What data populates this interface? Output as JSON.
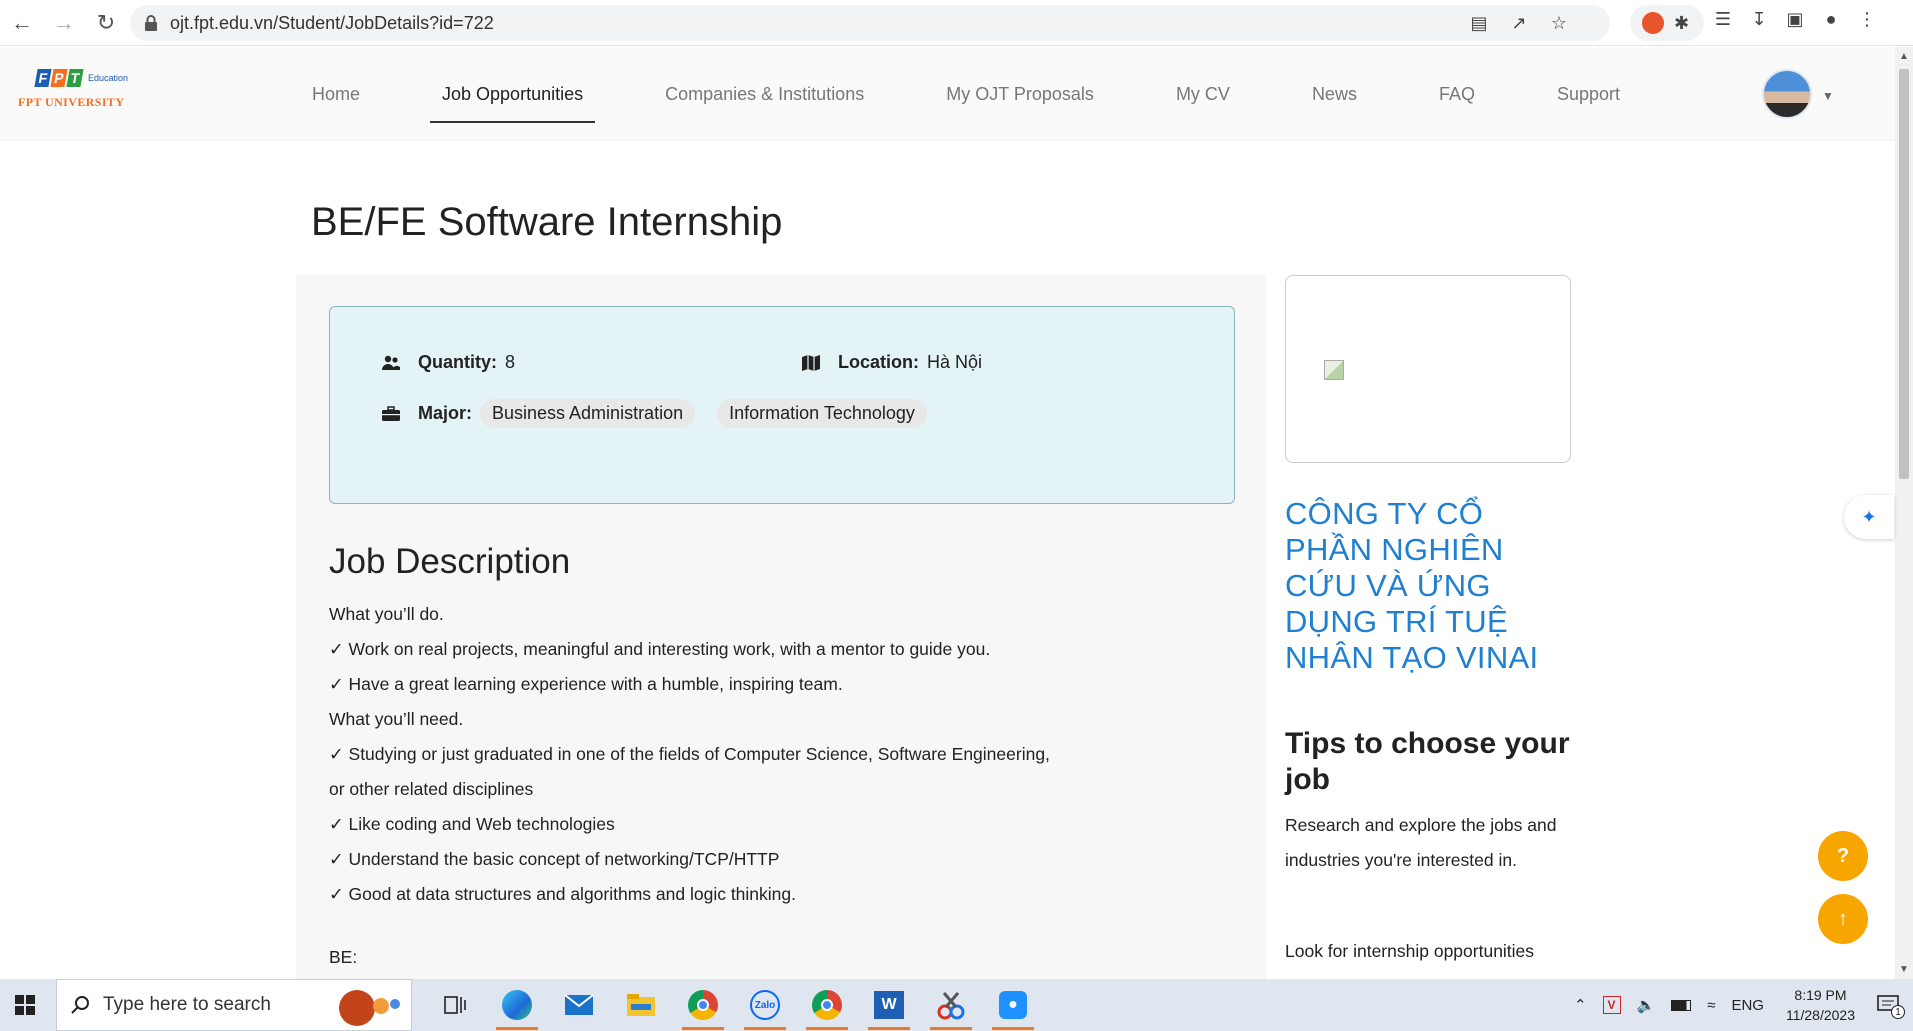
{
  "browser": {
    "url": "ojt.fpt.edu.vn/Student/JobDetails?id=722"
  },
  "header": {
    "logo": {
      "top": "Education",
      "bottom": "FPT UNIVERSITY"
    },
    "nav": [
      {
        "label": "Home",
        "active": false
      },
      {
        "label": "Job Opportunities",
        "active": true
      },
      {
        "label": "Companies & Institutions",
        "active": false
      },
      {
        "label": "My OJT Proposals",
        "active": false
      },
      {
        "label": "My CV",
        "active": false
      },
      {
        "label": "News",
        "active": false
      },
      {
        "label": "FAQ",
        "active": false
      },
      {
        "label": "Support",
        "active": false
      }
    ]
  },
  "job": {
    "title": "BE/FE Software Internship",
    "quantity_label": "Quantity:",
    "quantity": "8",
    "location_label": "Location:",
    "location": "Hà Nội",
    "major_label": "Major:",
    "majors": [
      "Business Administration",
      "Information Technology"
    ]
  },
  "description": {
    "title": "Job Description",
    "lines": [
      "What you’ll do.",
      "✓ Work on real projects, meaningful and interesting work, with a mentor to guide you.",
      "✓ Have a great learning experience with a humble, inspiring team.",
      "What you’ll need.",
      "✓ Studying or just graduated in one of the fields of Computer Science, Software Engineering,",
      "or other related disciplines",
      "✓ Like coding and Web technologies",
      "✓ Understand the basic concept of networking/TCP/HTTP",
      "✓ Good at data structures and algorithms and logic thinking."
    ],
    "be_label": "BE:"
  },
  "company": {
    "name": "CÔNG TY CỔ PHẦN NGHIÊN CỨU VÀ ỨNG DỤNG TRÍ TUỆ NHÂN TẠO VINAI"
  },
  "tips": {
    "title": "Tips to choose your job",
    "text1": "Research and explore the jobs and industries you're interested in.",
    "text2": "Look for internship opportunities"
  },
  "taskbar": {
    "search_placeholder": "Type here to search",
    "lang": "ENG",
    "time": "8:19 PM",
    "date": "11/28/2023",
    "notification_count": "1"
  },
  "colors": {
    "accent_orange": "#f7a600",
    "company_blue": "#1f7fd0",
    "info_card_bg": "#e3f3f6"
  }
}
